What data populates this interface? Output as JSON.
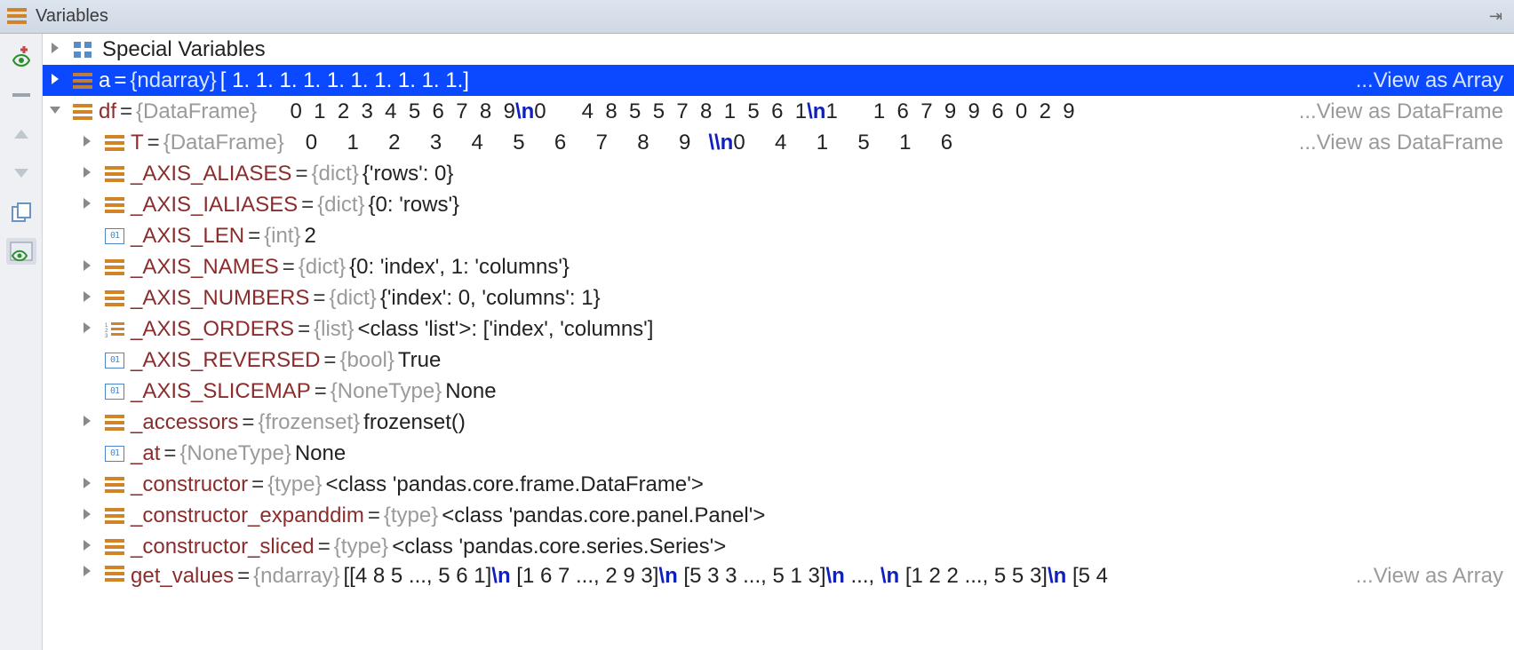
{
  "header": {
    "title": "Variables"
  },
  "special_label": "Special Variables",
  "rows": [
    {
      "name": "a",
      "type": "{ndarray}",
      "value": " [ 1.  1.  1.  1.  1.  1.  1.  1.  1.  1.] ",
      "link": "...View as Array"
    },
    {
      "name": "df",
      "type": "{DataFrame}",
      "pre": "     0  1  2  3  4  5  6  7  8  9",
      "seg1_esc": "\\n",
      "seg1_text": "0      4  8  5  5  7  8  1  5  6  1",
      "seg2_esc": "\\n",
      "seg2_text": "1      1  6  7  9  9  6  0  2  9",
      "link": "...View as DataFrame"
    },
    {
      "name": "T",
      "type": "{DataFrame}",
      "pre": "   0     1     2     3     4     5     6     7     8     9   ",
      "seg1_esc": "\\\\n",
      "seg1_text": "0     4     1     5     1     6   ",
      "link": "...View as DataFrame"
    },
    {
      "name": "_AXIS_ALIASES",
      "type": "{dict}",
      "value": " {'rows': 0}"
    },
    {
      "name": "_AXIS_IALIASES",
      "type": "{dict}",
      "value": " {0: 'rows'}"
    },
    {
      "name": "_AXIS_LEN",
      "type": "{int}",
      "value": " 2"
    },
    {
      "name": "_AXIS_NAMES",
      "type": "{dict}",
      "value": " {0: 'index', 1: 'columns'}"
    },
    {
      "name": "_AXIS_NUMBERS",
      "type": "{dict}",
      "value": " {'index': 0, 'columns': 1}"
    },
    {
      "name": "_AXIS_ORDERS",
      "type": "{list}",
      "value": " <class 'list'>: ['index', 'columns']"
    },
    {
      "name": "_AXIS_REVERSED",
      "type": "{bool}",
      "value": " True"
    },
    {
      "name": "_AXIS_SLICEMAP",
      "type": "{NoneType}",
      "value": " None"
    },
    {
      "name": "_accessors",
      "type": "{frozenset}",
      "value": " frozenset()"
    },
    {
      "name": "_at",
      "type": "{NoneType}",
      "value": " None"
    },
    {
      "name": "_constructor",
      "type": "{type}",
      "value": " <class 'pandas.core.frame.DataFrame'>"
    },
    {
      "name": "_constructor_expanddim",
      "type": "{type}",
      "value": " <class 'pandas.core.panel.Panel'>"
    },
    {
      "name": "_constructor_sliced",
      "type": "{type}",
      "value": " <class 'pandas.core.series.Series'>"
    },
    {
      "name": "get_values",
      "type": "{ndarray}",
      "parts": [
        " [[4 8 5 ..., 5 6 1]",
        "\\n",
        " [1 6 7 ..., 2 9 3]",
        "\\n",
        " [5 3 3 ..., 5 1 3]",
        "\\n",
        " ..., ",
        "\\n",
        " [1 2 2 ..., 5 5 3]",
        "\\n",
        " [5 4"
      ],
      "link": "...View as Array"
    }
  ]
}
